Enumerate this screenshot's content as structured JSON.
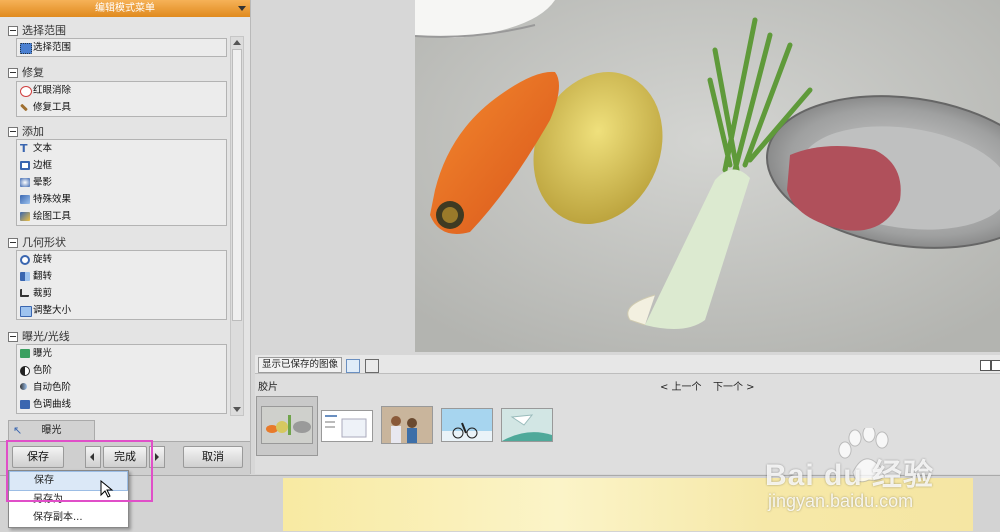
{
  "panel": {
    "title": "编辑模式菜单",
    "sections": [
      {
        "title": "选择范围",
        "items": [
          {
            "label": "选择范围",
            "icon": "selection-icon",
            "color": "#4a7fd0"
          }
        ]
      },
      {
        "title": "修复",
        "items": [
          {
            "label": "红眼消除",
            "icon": "red-eye-icon",
            "color": "#d04040"
          },
          {
            "label": "修复工具",
            "icon": "repair-icon",
            "color": "#a07030"
          }
        ]
      },
      {
        "title": "添加",
        "items": [
          {
            "label": "文本",
            "icon": "text-icon",
            "color": "#3a66b0"
          },
          {
            "label": "边框",
            "icon": "border-icon",
            "color": "#3a66b0"
          },
          {
            "label": "晕影",
            "icon": "vignette-icon",
            "color": "#3a66b0"
          },
          {
            "label": "特殊效果",
            "icon": "effects-icon",
            "color": "#3a66b0"
          },
          {
            "label": "绘图工具",
            "icon": "draw-icon",
            "color": "#3a66b0"
          }
        ]
      },
      {
        "title": "几何形状",
        "items": [
          {
            "label": "旋转",
            "icon": "rotate-icon",
            "color": "#3a66b0"
          },
          {
            "label": "翻转",
            "icon": "flip-icon",
            "color": "#3a66b0"
          },
          {
            "label": "裁剪",
            "icon": "crop-icon",
            "color": "#333333"
          },
          {
            "label": "调整大小",
            "icon": "resize-icon",
            "color": "#3a66b0"
          }
        ]
      },
      {
        "title": "曝光/光线",
        "items": [
          {
            "label": "曝光",
            "icon": "exposure-icon",
            "color": "#3aa060"
          },
          {
            "label": "色阶",
            "icon": "levels-icon",
            "color": "#222222"
          },
          {
            "label": "自动色阶",
            "icon": "auto-levels-icon",
            "color": "#3a66b0"
          },
          {
            "label": "色调曲线",
            "icon": "curves-icon",
            "color": "#3a66b0"
          }
        ]
      }
    ],
    "active_tab": "曝光",
    "buttons": {
      "save": "保存",
      "done": "完成",
      "cancel": "取消"
    },
    "dropdown": [
      "保存",
      "另存为",
      "保存副本..."
    ]
  },
  "filmstrip": {
    "saved_label": "显示已保存的图像",
    "film_label": "胶片",
    "prev": "< 上一个",
    "next": "下一个 >"
  },
  "watermark": {
    "brand": "Bai du 经验",
    "url": "jingyan.baidu.com"
  }
}
